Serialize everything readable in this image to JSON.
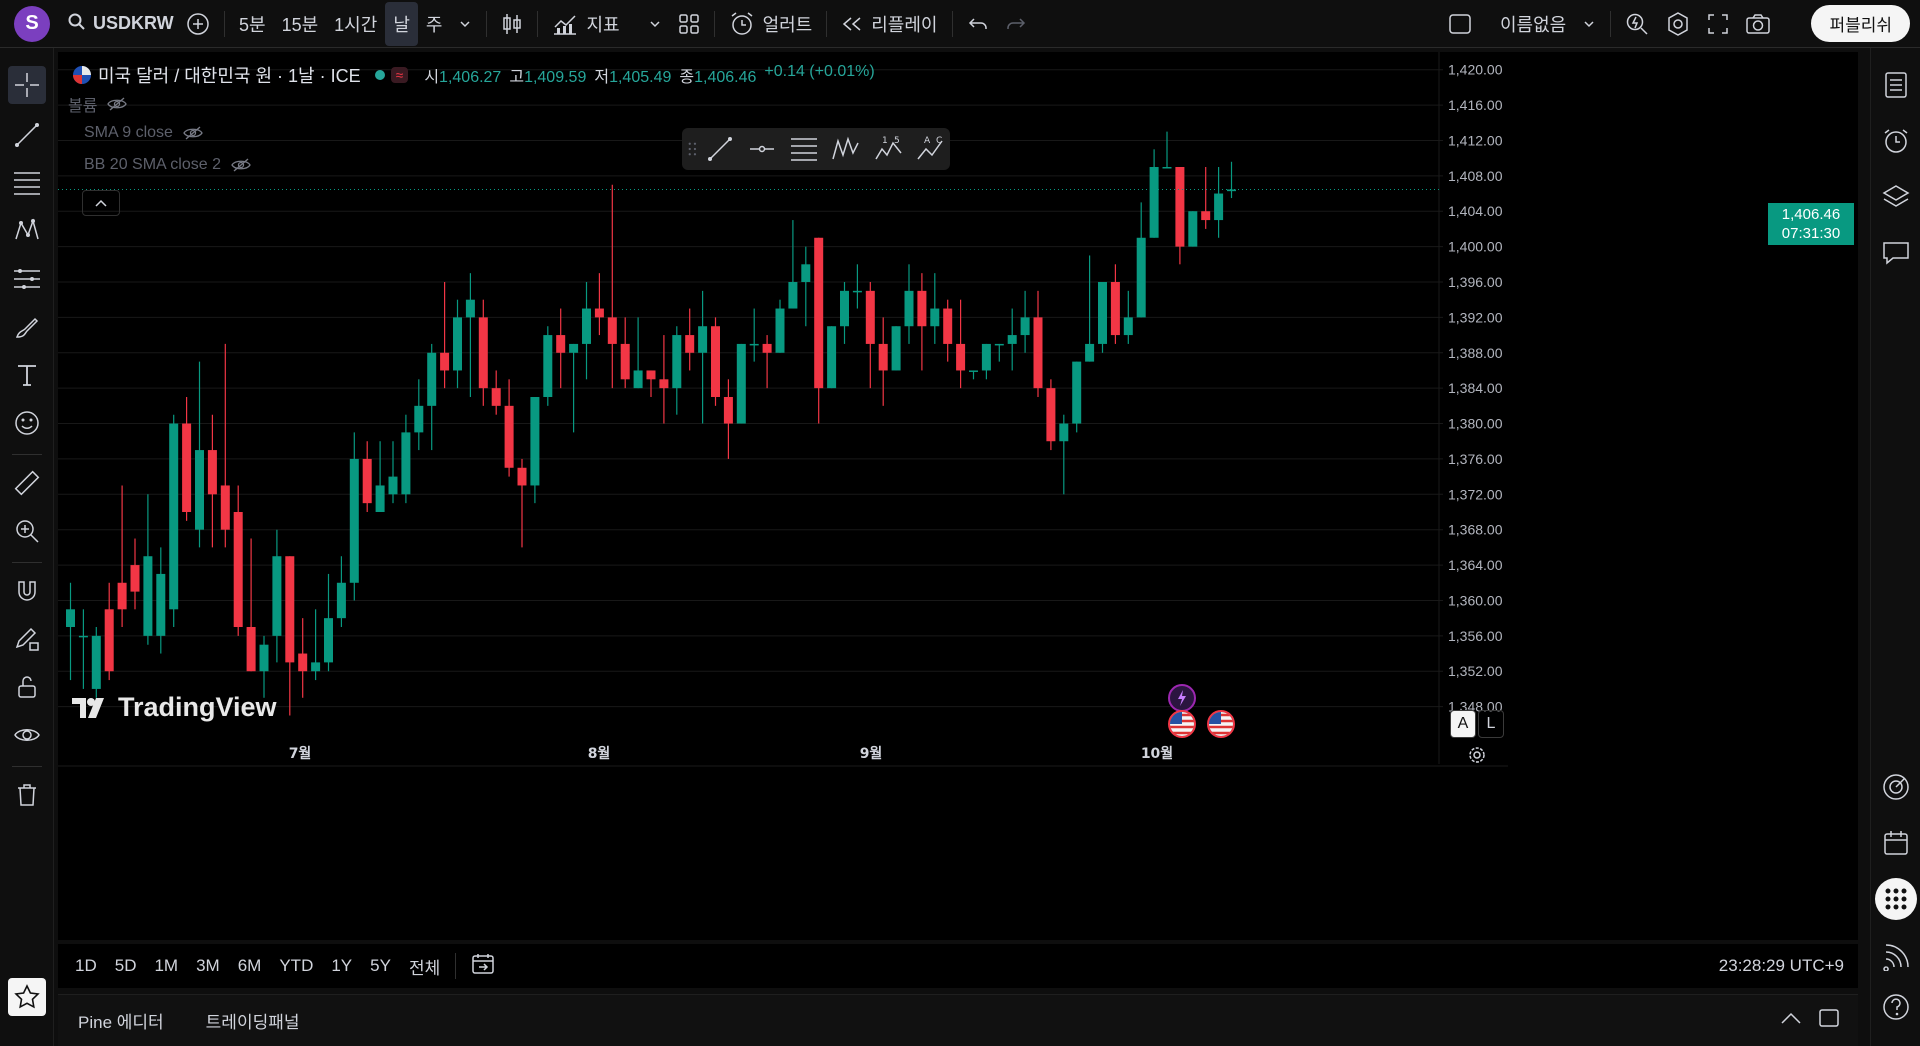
{
  "top_bar": {
    "avatar_letter": "S",
    "symbol": "USDKRW",
    "intervals": [
      "5분",
      "15분",
      "1시간",
      "날",
      "주"
    ],
    "active_interval": "날",
    "indicators_label": "지표",
    "alert_label": "얼러트",
    "replay_label": "리플레이",
    "layout_name": "이름없음",
    "publish_label": "퍼블리쉬"
  },
  "legend": {
    "title": "미국 달러 / 대한민국 원 · 1날 · ICE",
    "open_label": "시",
    "open": "1,406.27",
    "high_label": "고",
    "high": "1,409.59",
    "low_label": "저",
    "low": "1,405.49",
    "close_label": "종",
    "close": "1,406.46",
    "change": "+0.14 (+0.01%)",
    "volume_label": "볼륨",
    "sma_label": "SMA 9 close",
    "bb_label": "BB 20 SMA close 2"
  },
  "price_tag": {
    "price": "1,406.46",
    "countdown": "07:31:30"
  },
  "watermark": "TradingView",
  "range_bar": {
    "ranges": [
      "1D",
      "5D",
      "1M",
      "3M",
      "6M",
      "YTD",
      "1Y",
      "5Y",
      "전체"
    ],
    "clock": "23:28:29 UTC+9"
  },
  "bottom_panel": {
    "tabs": [
      "Pine 에디터",
      "트레이딩패널"
    ]
  },
  "scale_buttons": [
    "A",
    "L"
  ],
  "colors": {
    "up": "#089981",
    "down": "#f23645",
    "accent": "#7b3fbf"
  },
  "chart_data": {
    "type": "candlestick",
    "y_ticks": [
      "1,420.00",
      "1,416.00",
      "1,412.00",
      "1,408.00",
      "1,404.00",
      "1,400.00",
      "1,396.00",
      "1,392.00",
      "1,388.00",
      "1,384.00",
      "1,380.00",
      "1,376.00",
      "1,372.00",
      "1,368.00",
      "1,364.00",
      "1,360.00",
      "1,356.00",
      "1,352.00",
      "1,348.00"
    ],
    "ylim": [
      1344,
      1422
    ],
    "x_labels": [
      "7월",
      "8월",
      "9월",
      "10월"
    ],
    "last_price": 1406.46,
    "candles": [
      [
        1357,
        1359,
        1351,
        1362
      ],
      [
        1356,
        1356,
        1350,
        1359
      ],
      [
        1350,
        1356,
        1349,
        1357
      ],
      [
        1359,
        1352,
        1351,
        1362
      ],
      [
        1362,
        1359,
        1357,
        1373
      ],
      [
        1364,
        1361,
        1359,
        1367
      ],
      [
        1356,
        1365,
        1355,
        1372
      ],
      [
        1356,
        1363,
        1354,
        1366
      ],
      [
        1359,
        1380,
        1357,
        1381
      ],
      [
        1380,
        1370,
        1369,
        1383
      ],
      [
        1368,
        1377,
        1366,
        1387
      ],
      [
        1377,
        1372,
        1366,
        1381
      ],
      [
        1373,
        1368,
        1366,
        1389
      ],
      [
        1370,
        1357,
        1356,
        1373
      ],
      [
        1357,
        1352,
        1352,
        1367
      ],
      [
        1352,
        1355,
        1349,
        1356
      ],
      [
        1356,
        1365,
        1353,
        1368
      ],
      [
        1365,
        1353,
        1347,
        1365
      ],
      [
        1354,
        1352,
        1349,
        1358
      ],
      [
        1352,
        1353,
        1351,
        1359
      ],
      [
        1353,
        1358,
        1352,
        1363
      ],
      [
        1358,
        1362,
        1357,
        1365
      ],
      [
        1362,
        1376,
        1360,
        1379
      ],
      [
        1376,
        1371,
        1370,
        1378
      ],
      [
        1370,
        1373,
        1370,
        1378
      ],
      [
        1372,
        1374,
        1371,
        1378
      ],
      [
        1372,
        1379,
        1371,
        1381
      ],
      [
        1379,
        1382,
        1377,
        1385
      ],
      [
        1382,
        1388,
        1377,
        1389
      ],
      [
        1388,
        1386,
        1384,
        1396
      ],
      [
        1386,
        1392,
        1384,
        1394
      ],
      [
        1392,
        1394,
        1383,
        1397
      ],
      [
        1392,
        1384,
        1382,
        1394
      ],
      [
        1384,
        1382,
        1381,
        1386
      ],
      [
        1382,
        1375,
        1374,
        1385
      ],
      [
        1375,
        1373,
        1366,
        1376
      ],
      [
        1373,
        1383,
        1371,
        1383
      ],
      [
        1383,
        1390,
        1382,
        1391
      ],
      [
        1390,
        1388,
        1384,
        1393
      ],
      [
        1388,
        1389,
        1379,
        1389
      ],
      [
        1389,
        1393,
        1385,
        1396
      ],
      [
        1393,
        1392,
        1390,
        1397
      ],
      [
        1392,
        1389,
        1384,
        1407
      ],
      [
        1389,
        1385,
        1384,
        1392
      ],
      [
        1384,
        1386,
        1384,
        1392
      ],
      [
        1386,
        1385,
        1383,
        1386
      ],
      [
        1385,
        1384,
        1380,
        1390
      ],
      [
        1384,
        1390,
        1381,
        1391
      ],
      [
        1390,
        1388,
        1386,
        1393
      ],
      [
        1388,
        1391,
        1380,
        1395
      ],
      [
        1391,
        1383,
        1382,
        1392
      ],
      [
        1383,
        1380,
        1376,
        1385
      ],
      [
        1380,
        1389,
        1380,
        1389
      ],
      [
        1389,
        1389,
        1387,
        1393
      ],
      [
        1389,
        1388,
        1384,
        1390
      ],
      [
        1388,
        1393,
        1388,
        1394
      ],
      [
        1393,
        1396,
        1393,
        1403
      ],
      [
        1396,
        1398,
        1391,
        1400
      ],
      [
        1401,
        1384,
        1380,
        1401
      ],
      [
        1384,
        1391,
        1384,
        1391
      ],
      [
        1391,
        1395,
        1389,
        1396
      ],
      [
        1395,
        1395,
        1393,
        1398
      ],
      [
        1395,
        1389,
        1384,
        1396
      ],
      [
        1389,
        1386,
        1382,
        1392
      ],
      [
        1386,
        1391,
        1386,
        1391
      ],
      [
        1391,
        1395,
        1389,
        1398
      ],
      [
        1395,
        1391,
        1386,
        1397
      ],
      [
        1391,
        1393,
        1389,
        1397
      ],
      [
        1393,
        1389,
        1387,
        1394
      ],
      [
        1389,
        1386,
        1384,
        1394
      ],
      [
        1386,
        1386,
        1385,
        1386
      ],
      [
        1386,
        1389,
        1385,
        1389
      ],
      [
        1389,
        1389,
        1387,
        1389
      ],
      [
        1389,
        1390,
        1386,
        1393
      ],
      [
        1390,
        1392,
        1388,
        1395
      ],
      [
        1392,
        1384,
        1383,
        1395
      ],
      [
        1384,
        1378,
        1377,
        1385
      ],
      [
        1378,
        1380,
        1372,
        1381
      ],
      [
        1380,
        1387,
        1379,
        1387
      ],
      [
        1387,
        1389,
        1387,
        1399
      ],
      [
        1389,
        1396,
        1388,
        1396
      ],
      [
        1396,
        1390,
        1389,
        1398
      ],
      [
        1390,
        1392,
        1389,
        1395
      ],
      [
        1392,
        1401,
        1392,
        1405
      ],
      [
        1401,
        1409,
        1401,
        1411
      ],
      [
        1409,
        1409,
        1409,
        1413
      ],
      [
        1409,
        1400,
        1398,
        1409
      ],
      [
        1400,
        1404,
        1400,
        1404
      ],
      [
        1404,
        1403,
        1402,
        1409
      ],
      [
        1403,
        1406,
        1401,
        1409
      ],
      [
        1406.27,
        1406.46,
        1405.49,
        1409.59
      ]
    ]
  }
}
